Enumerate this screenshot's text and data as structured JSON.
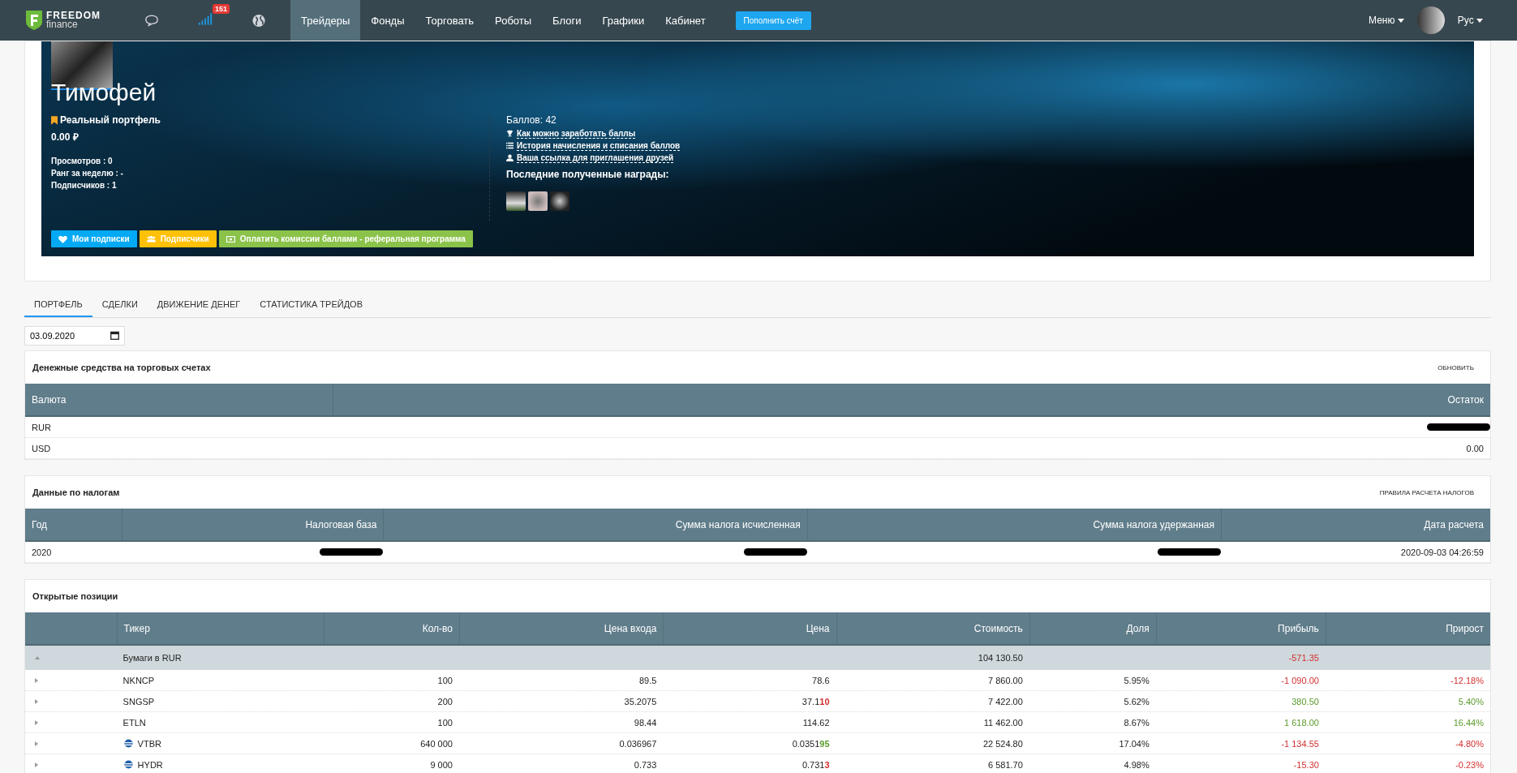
{
  "nav": {
    "logo": {
      "line1": "FREEDOM",
      "line2": "finance"
    },
    "badge": "151",
    "items": [
      {
        "label": "Трейдеры",
        "selected": true
      },
      {
        "label": "Фонды",
        "selected": false
      },
      {
        "label": "Торговать",
        "selected": false
      },
      {
        "label": "Роботы",
        "selected": false
      },
      {
        "label": "Блоги",
        "selected": false
      },
      {
        "label": "Графики",
        "selected": false
      },
      {
        "label": "Кабинет",
        "selected": false
      }
    ],
    "deposit_button": "Пополнить счёт",
    "menu": "Меню",
    "language": "Рус"
  },
  "profile": {
    "name": "Тимофей",
    "portfolio_label": "Реальный портфель",
    "balance": "0.00 ₽",
    "stats": [
      "Просмотров : 0",
      "Ранг за неделю : -",
      "Подписчиков : 1"
    ],
    "points": "Баллов: 42",
    "links": [
      {
        "label": "Как можно заработать баллы"
      },
      {
        "label": "История начисления и списания баллов"
      },
      {
        "label": "Ваша ссылка для приглашения друзей"
      }
    ],
    "awards_title": "Последние полученные награды:",
    "buttons": [
      {
        "kind": "subscriptions",
        "label": "Мои подписки"
      },
      {
        "kind": "subscribers",
        "label": "Подписчики"
      },
      {
        "kind": "referral",
        "label": "Оплатить комиссии баллами - реферальная программа"
      }
    ]
  },
  "tabs": [
    {
      "label": "ПОРТФЕЛЬ",
      "selected": true
    },
    {
      "label": "СДЕЛКИ",
      "selected": false
    },
    {
      "label": "ДВИЖЕНИЕ ДЕНЕГ",
      "selected": false
    },
    {
      "label": "СТАТИСТИКА ТРЕЙДОВ",
      "selected": false
    }
  ],
  "date_field": {
    "value": "03.09.2020"
  },
  "cash": {
    "title": "Денежные средства на торговых счетах",
    "action": "ОБНОВИТЬ",
    "columns": [
      "Валюта",
      "Остаток"
    ],
    "rows": [
      {
        "currency": "RUR",
        "balance": "",
        "redacted": true
      },
      {
        "currency": "USD",
        "balance": "0.00",
        "redacted": false
      }
    ]
  },
  "taxes": {
    "title": "Данные по налогам",
    "action": "ПРАВИЛА РАСЧЕТА НАЛОГОВ",
    "columns": [
      "Год",
      "Налоговая база",
      "Сумма налога исчисленная",
      "Сумма налога удержанная",
      "Дата расчета"
    ],
    "rows": [
      {
        "cells": [
          {
            "text": "2020",
            "redacted": false
          },
          {
            "text": "",
            "redacted": true
          },
          {
            "text": "",
            "redacted": true
          },
          {
            "text": "",
            "redacted": true
          },
          {
            "text": "2020-09-03 04:26:59",
            "redacted": false
          }
        ]
      }
    ]
  },
  "positions": {
    "title": "Открытые позиции",
    "columns": [
      "Тикер",
      "Кол-во",
      "Цена входа",
      "Цена",
      "Стоимость",
      "Доля",
      "Прибыль",
      "Прирост"
    ],
    "group": {
      "label": "Бумаги в RUR",
      "expanded": true,
      "value": "104 130.50",
      "profit": "-571.35",
      "color": "#d32f2f"
    },
    "rows": [
      {
        "ticker": "NKNCP",
        "logo": false,
        "qty": "100",
        "entry": "89.5",
        "price": "78.6",
        "value": "7 860.00",
        "share": "5.95%",
        "profit": "-1 090.00",
        "growth": "-12.18%",
        "color": "#d32f2f"
      },
      {
        "ticker": "SNGSP",
        "logo": false,
        "qty": "200",
        "entry": "35.2075",
        "price": "37.1",
        "price_tail": {
          "text": "10",
          "color": "#d32f2f"
        },
        "value": "7 422.00",
        "share": "5.62%",
        "profit": "380.50",
        "growth": "5.40%",
        "color": "#5a9a2b"
      },
      {
        "ticker": "ETLN",
        "logo": false,
        "qty": "100",
        "entry": "98.44",
        "price": "114.62",
        "value": "11 462.00",
        "share": "8.67%",
        "profit": "1 618.00",
        "growth": "16.44%",
        "color": "#5a9a2b"
      },
      {
        "ticker": "VTBR",
        "logo": true,
        "qty": "640 000",
        "entry": "0.036967",
        "price": "0.0351",
        "price_tail": {
          "text": "95",
          "color": "#5a9a2b"
        },
        "value": "22 524.80",
        "share": "17.04%",
        "profit": "-1 134.55",
        "growth": "-4.80%",
        "color": "#d32f2f"
      },
      {
        "ticker": "HYDR",
        "logo": true,
        "qty": "9 000",
        "entry": "0.733",
        "price": "0.731",
        "price_tail": {
          "text": "3",
          "color": "#d32f2f"
        },
        "value": "6 581.70",
        "share": "4.98%",
        "profit": "-15.30",
        "growth": "-0.23%",
        "color": "#d32f2f"
      }
    ]
  }
}
